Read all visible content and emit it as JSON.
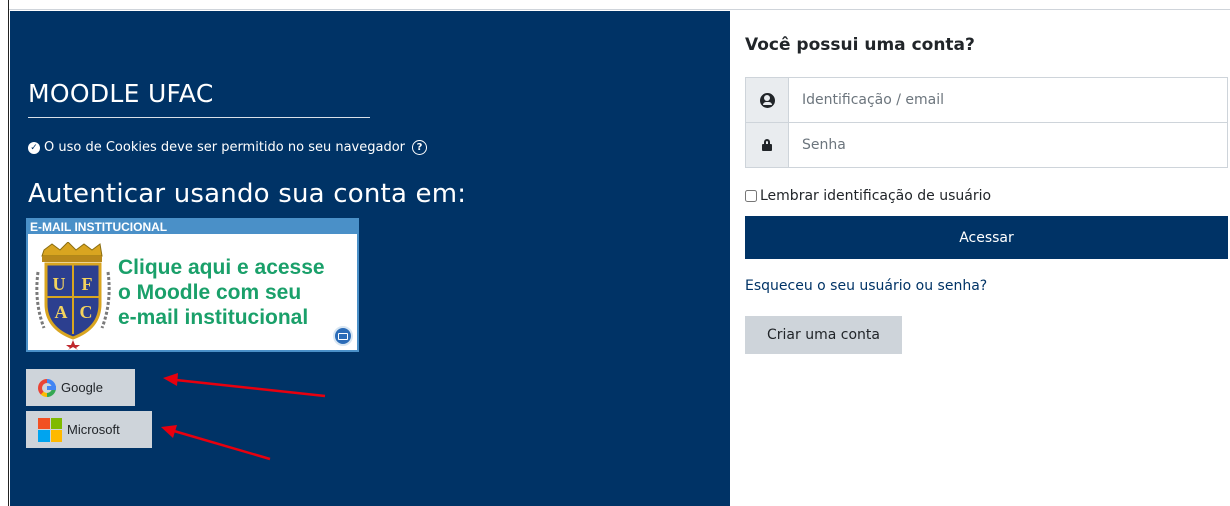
{
  "left": {
    "site_title": "MOODLE UFAC",
    "cookie_notice": "O uso de Cookies deve ser permitido no seu navegador",
    "auth_heading": "Autenticar usando sua conta em:",
    "banner": {
      "header": "E-MAIL INSTITUCIONAL",
      "crest_letters": [
        "U",
        "F",
        "A",
        "C"
      ],
      "lines": [
        "Clique aqui e acesse",
        "o Moodle com seu",
        "e-mail institucional"
      ]
    },
    "oauth": {
      "google_label": "Google",
      "microsoft_label": "Microsoft"
    }
  },
  "right": {
    "title": "Você possui uma conta?",
    "username_placeholder": "Identificação / email",
    "password_placeholder": "Senha",
    "remember_label": "Lembrar identificação de usuário",
    "login_button": "Acessar",
    "forgot_link": "Esqueceu o seu usuário ou senha?",
    "create_account": "Criar uma conta"
  },
  "colors": {
    "brand_navy": "#003366",
    "button_gray": "#ced4da",
    "banner_green": "#1aa06a",
    "banner_blue": "#4a90c8",
    "annotation_red": "#e8000e"
  }
}
